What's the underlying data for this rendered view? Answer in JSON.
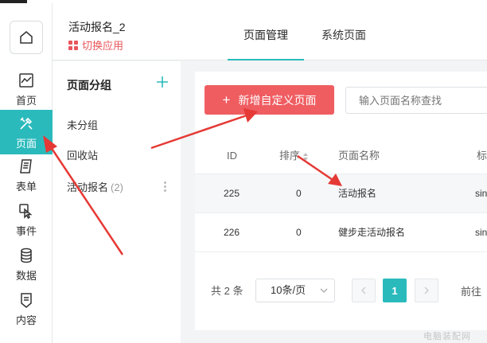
{
  "rail": {
    "items": [
      {
        "label": "首页",
        "icon": "chart-icon"
      },
      {
        "label": "页面",
        "icon": "tools-icon",
        "active": true
      },
      {
        "label": "表单",
        "icon": "form-icon"
      },
      {
        "label": "事件",
        "icon": "pointer-icon"
      },
      {
        "label": "数据",
        "icon": "database-icon"
      },
      {
        "label": "内容",
        "icon": "document-icon"
      }
    ]
  },
  "header": {
    "app_name": "活动报名_2",
    "switch_label": "切换应用",
    "tabs": [
      {
        "label": "页面管理",
        "active": true
      },
      {
        "label": "系统页面",
        "active": false
      }
    ]
  },
  "groups": {
    "title": "页面分组",
    "items": [
      {
        "label": "未分组",
        "count": ""
      },
      {
        "label": "回收站",
        "count": ""
      },
      {
        "label": "活动报名",
        "count": "(2)"
      }
    ]
  },
  "toolbar": {
    "new_page_label": "新增自定义页面",
    "search_placeholder": "输入页面名称查找"
  },
  "table": {
    "columns": [
      "ID",
      "排序",
      "页面名称",
      "标"
    ],
    "rows": [
      {
        "id": "225",
        "order": "0",
        "name": "活动报名",
        "tag": "sin"
      },
      {
        "id": "226",
        "order": "0",
        "name": "健步走活动报名",
        "tag": "sin"
      }
    ]
  },
  "pagination": {
    "total": "共 2 条",
    "page_size": "10条/页",
    "current_page": "1",
    "goto_label": "前往"
  },
  "watermark": "电脑装配网",
  "colors": {
    "accent": "#2bbabc",
    "primary_button": "#ef5d61",
    "switch_text": "#e9575c",
    "annotation_arrow": "#e53935"
  }
}
